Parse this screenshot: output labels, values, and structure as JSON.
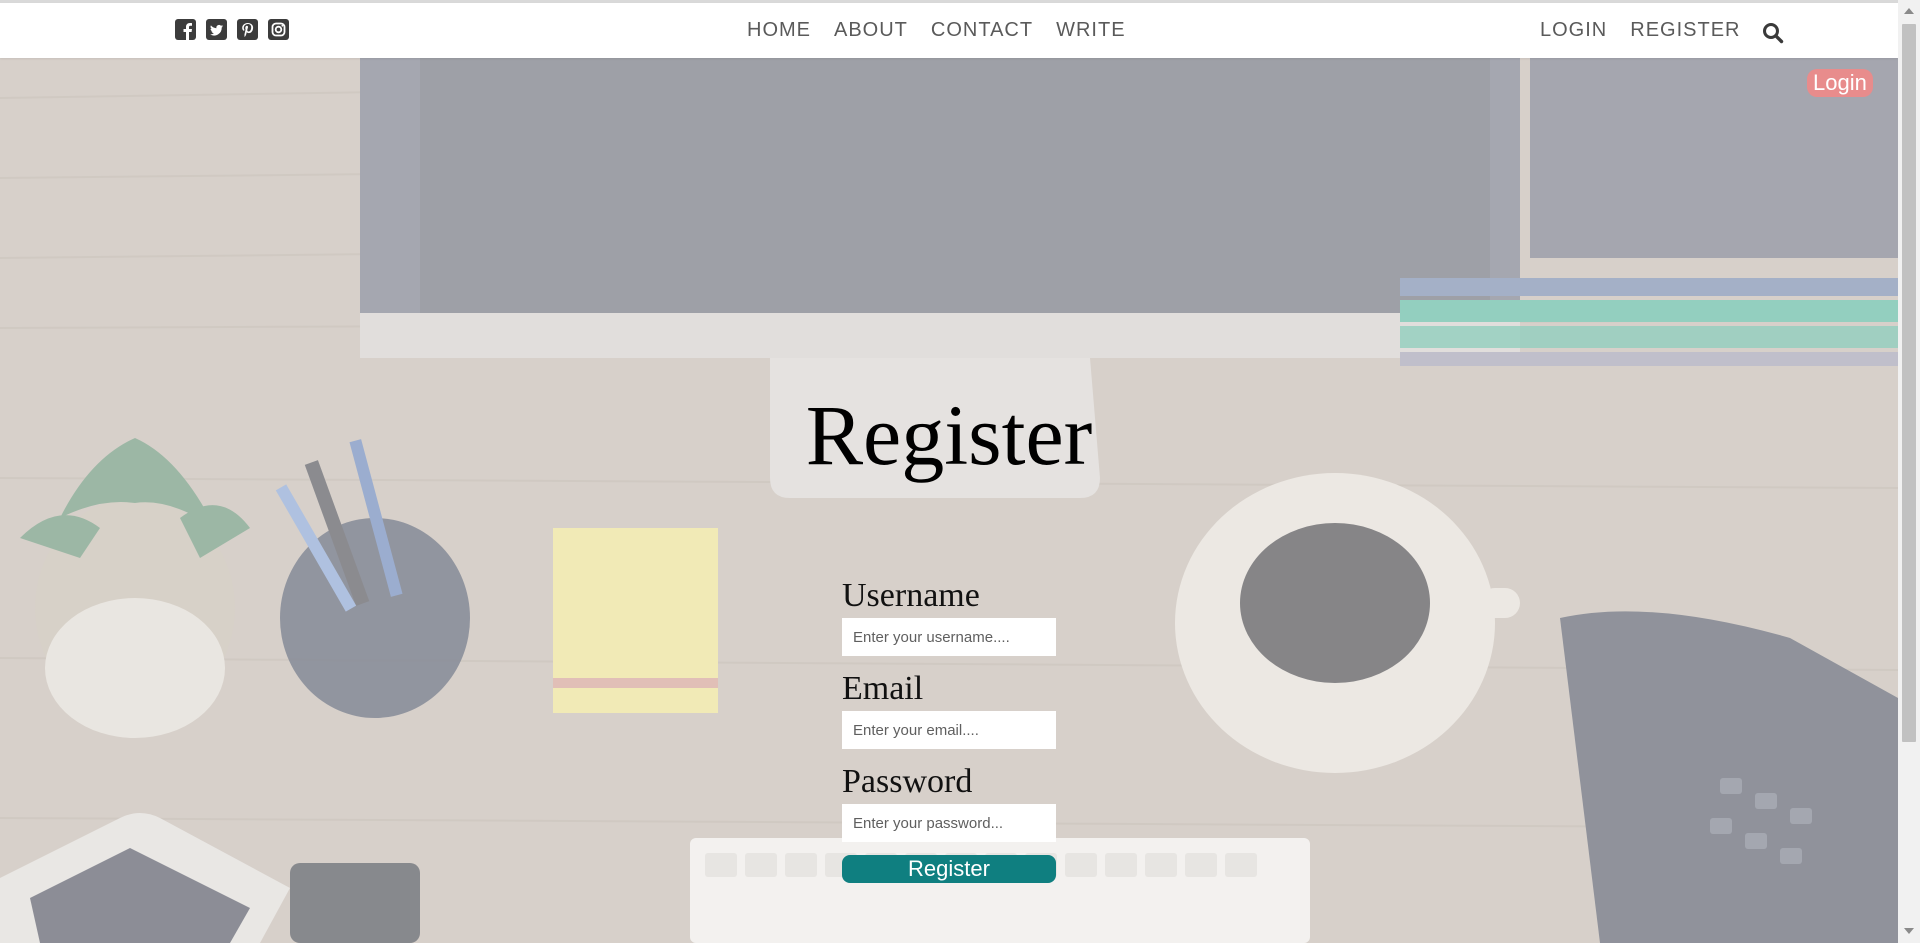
{
  "social": [
    "facebook-icon",
    "twitter-icon",
    "pinterest-icon",
    "instagram-icon"
  ],
  "nav": {
    "home": "HOME",
    "about": "ABOUT",
    "contact": "CONTACT",
    "write": "WRITE",
    "login": "LOGIN",
    "register": "REGISTER",
    "search_icon": "search-icon"
  },
  "hero": {
    "login_button": "Login",
    "title": "Register"
  },
  "form": {
    "username_label": "Username",
    "username_placeholder": "Enter your username....",
    "email_label": "Email",
    "email_placeholder": "Enter your email....",
    "password_label": "Password",
    "password_placeholder": "Enter your password...",
    "submit_label": "Register"
  },
  "colors": {
    "login_pill": "#e88c8c",
    "register_button": "#0f7f80",
    "nav_text": "#5a5a5a"
  }
}
